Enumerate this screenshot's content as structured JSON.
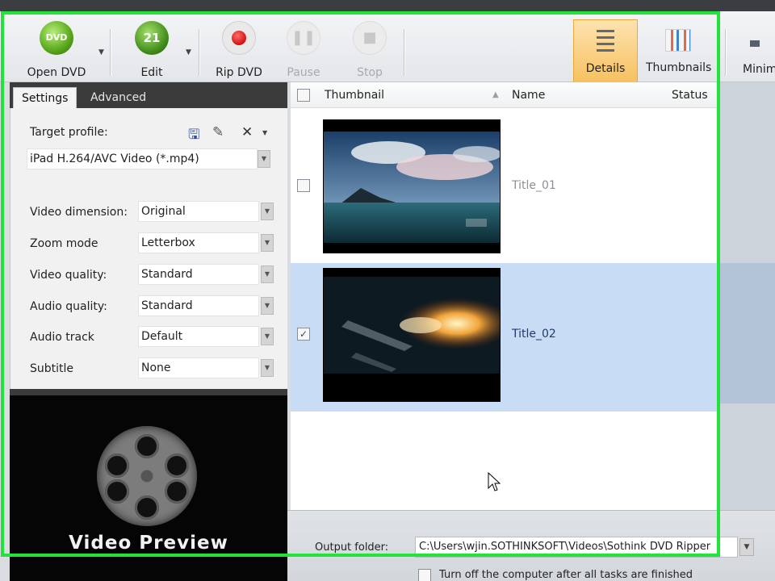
{
  "toolbar": {
    "open_dvd": "Open DVD",
    "open_dvd_badge": "DVD",
    "edit": "Edit",
    "edit_badge": "21",
    "rip_dvd": "Rip DVD",
    "pause": "Pause",
    "stop": "Stop",
    "details": "Details",
    "thumbnails": "Thumbnails",
    "minimize": "Minim"
  },
  "tabs": {
    "settings": "Settings",
    "advanced": "Advanced"
  },
  "settings": {
    "target_profile_label": "Target profile:",
    "target_profile_value": "iPad H.264/AVC Video (*.mp4)",
    "rows": [
      {
        "label": "Video dimension:",
        "value": "Original"
      },
      {
        "label": "Zoom mode",
        "value": "Letterbox"
      },
      {
        "label": "Video quality:",
        "value": "Standard"
      },
      {
        "label": "Audio quality:",
        "value": "Standard"
      },
      {
        "label": "Audio track",
        "value": "Default"
      },
      {
        "label": "Subtitle",
        "value": "None"
      }
    ]
  },
  "preview": {
    "title": "Video Preview"
  },
  "list": {
    "columns": {
      "thumbnail": "Thumbnail",
      "name": "Name",
      "status": "Status"
    },
    "items": [
      {
        "name": "Title_01",
        "checked": false,
        "check_mark": ""
      },
      {
        "name": "Title_02",
        "checked": true,
        "check_mark": "✓"
      }
    ]
  },
  "bottom": {
    "output_label": "Output folder:",
    "output_path": "C:\\Users\\wjin.SOTHINKSOFT\\Videos\\Sothink DVD Ripper",
    "shutdown_label": "Turn off the computer after all tasks are finished"
  },
  "colors": {
    "highlight": "#22e33a",
    "selection": "#c9dcf5",
    "active_view": "#f7bf5c"
  }
}
